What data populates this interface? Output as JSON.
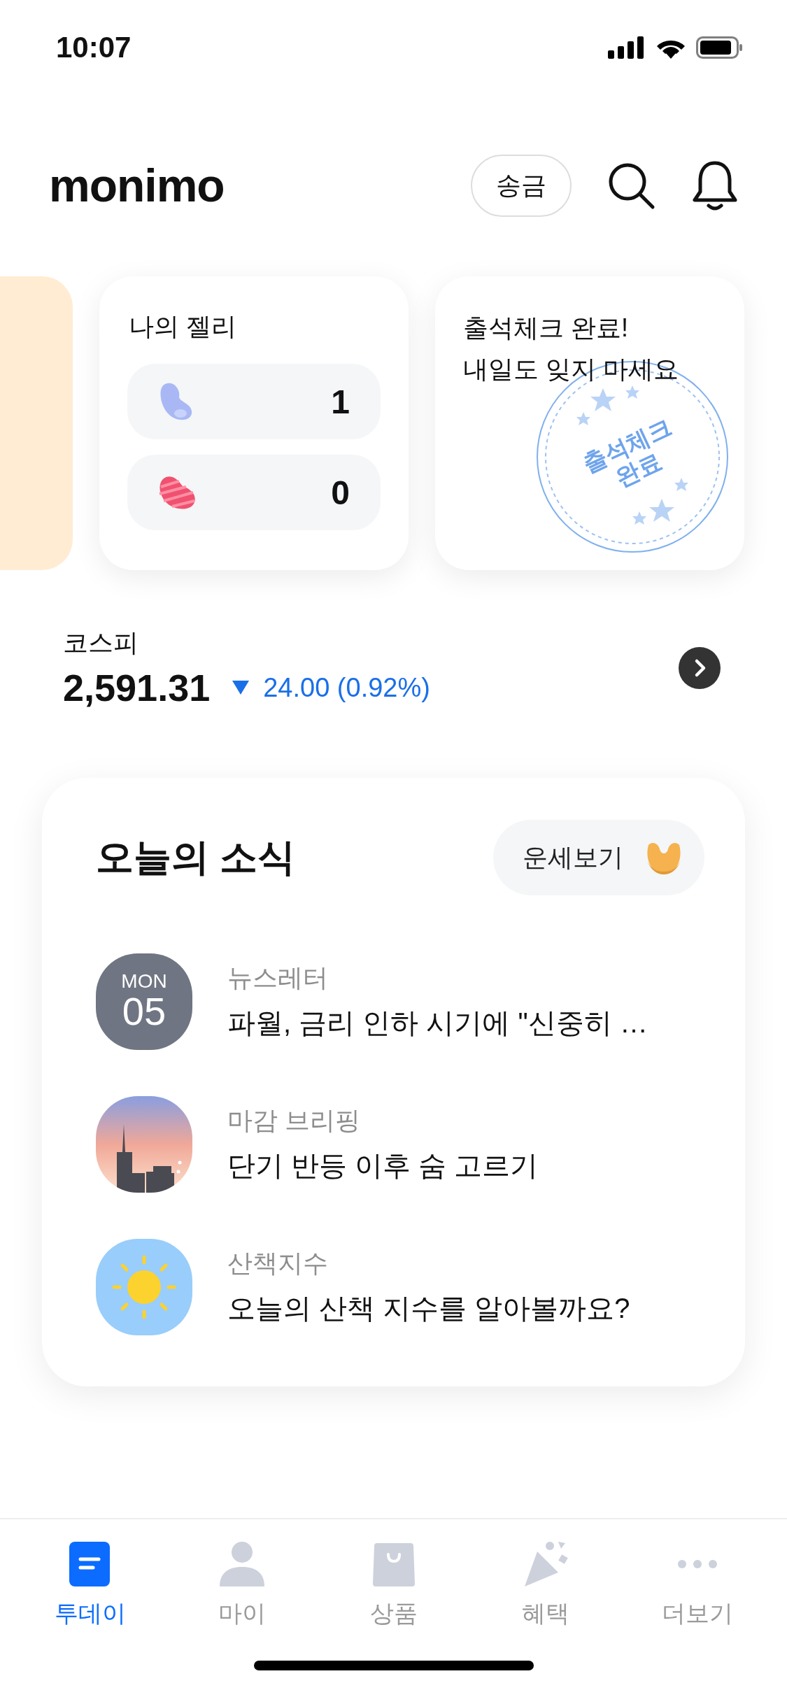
{
  "status_bar": {
    "time": "10:07"
  },
  "header": {
    "logo": "monimo",
    "transfer_button": "송금"
  },
  "jelly_card": {
    "title": "나의 젤리",
    "jellies": [
      {
        "kind": "plain",
        "count": "1"
      },
      {
        "kind": "striped",
        "count": "0"
      }
    ]
  },
  "attendance_card": {
    "lines": [
      "출석체크 완료!",
      "내일도 잊지 마세요"
    ],
    "stamp": [
      "출석체크",
      "완료"
    ]
  },
  "index": {
    "name": "코스피",
    "value": "2,591.31",
    "falling": true,
    "change": "24.00 (0.92%)"
  },
  "news": {
    "title": "오늘의 소식",
    "fortune_button": "운세보기",
    "items": [
      {
        "kind": "date",
        "weekday": "MON",
        "day": "05",
        "category": "뉴스레터",
        "headline": "파월, 금리 인하 시기에 \"신중히 …"
      },
      {
        "kind": "city",
        "category": "마감 브리핑",
        "headline": "단기 반등 이후 숨 고르기"
      },
      {
        "kind": "sun",
        "category": "산책지수",
        "headline": "오늘의 산책 지수를 알아볼까요?"
      }
    ]
  },
  "tab_bar": [
    {
      "kind": "today",
      "label": "투데이",
      "selected": true
    },
    {
      "kind": "my",
      "label": "마이",
      "selected": false
    },
    {
      "kind": "products",
      "label": "상품",
      "selected": false
    },
    {
      "kind": "benefits",
      "label": "혜택",
      "selected": false
    },
    {
      "kind": "more",
      "label": "더보기",
      "selected": false
    }
  ]
}
